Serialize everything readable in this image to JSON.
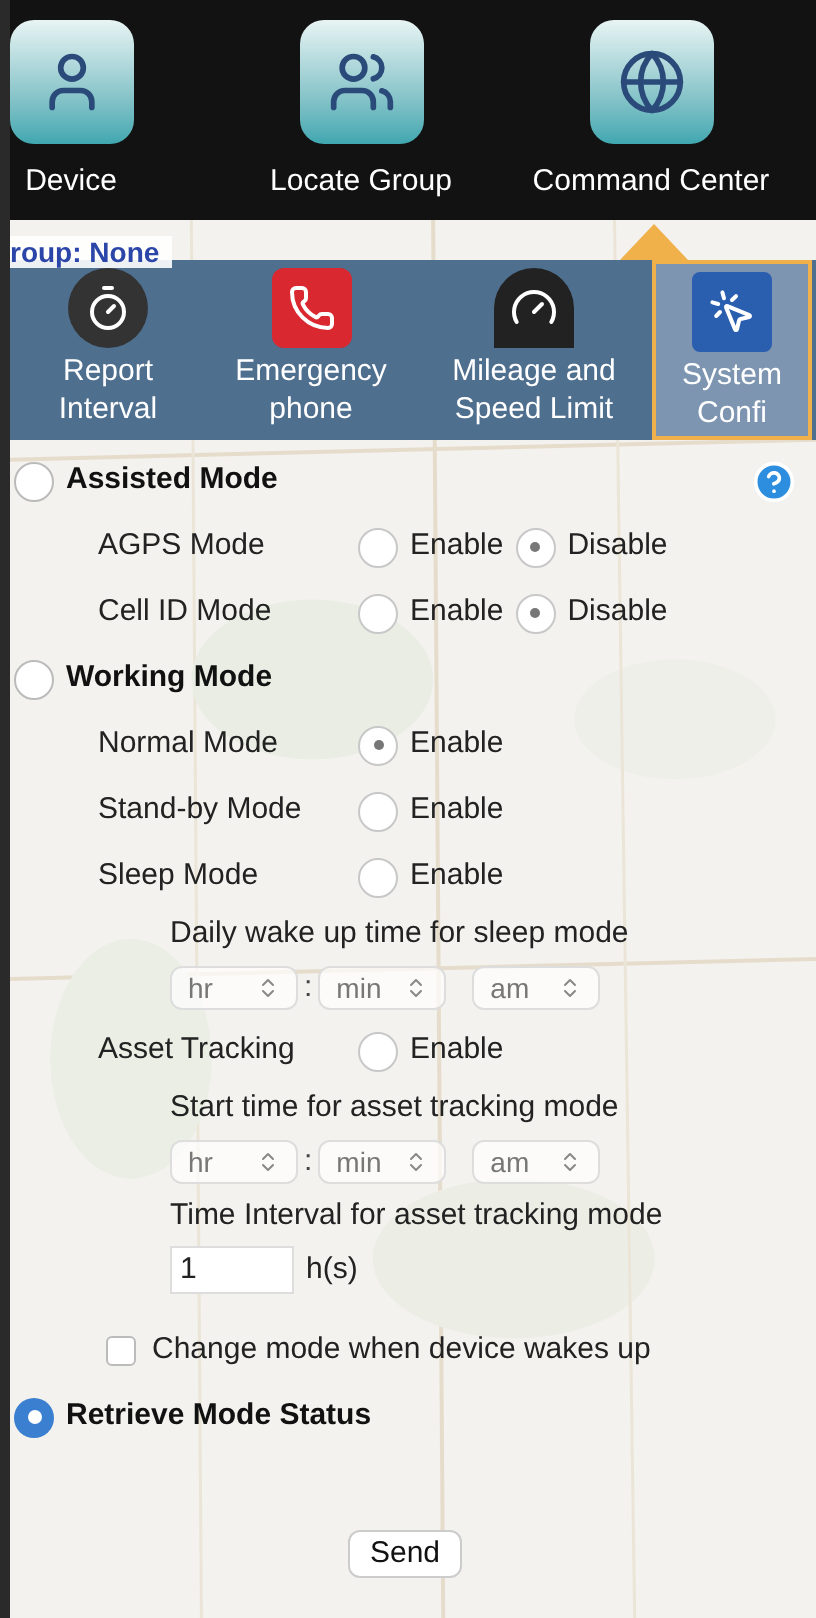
{
  "top_bar": {
    "apps": [
      {
        "label": "Device",
        "kind": "person"
      },
      {
        "label": "Locate Group",
        "kind": "group"
      },
      {
        "label": "Command Center",
        "kind": "globe"
      }
    ]
  },
  "group_label": "roup: None",
  "tool_tabs": [
    {
      "label": "Report Interval",
      "kind": "timer",
      "selected": false
    },
    {
      "label": "Emergency phone",
      "kind": "phone",
      "selected": false
    },
    {
      "label": "Mileage and Speed Limit",
      "kind": "gauge",
      "selected": false
    },
    {
      "label": "System Confi",
      "kind": "pointer",
      "selected": true
    }
  ],
  "modes": [
    {
      "title": "Assisted Mode",
      "selected": false,
      "items": [
        {
          "kind": "toggle",
          "label": "AGPS Mode",
          "options": [
            {
              "label": "Enable",
              "selected": false
            },
            {
              "label": "Disable",
              "selected": true
            }
          ]
        },
        {
          "kind": "toggle",
          "label": "Cell ID Mode",
          "options": [
            {
              "label": "Enable",
              "selected": false
            },
            {
              "label": "Disable",
              "selected": true
            }
          ]
        }
      ]
    },
    {
      "title": "Working Mode",
      "selected": false,
      "items": [
        {
          "kind": "toggle",
          "label": "Normal Mode",
          "options": [
            {
              "label": "Enable",
              "selected": true
            }
          ]
        },
        {
          "kind": "toggle",
          "label": "Stand-by Mode",
          "options": [
            {
              "label": "Enable",
              "selected": false
            }
          ]
        },
        {
          "kind": "toggle",
          "label": "Sleep Mode",
          "options": [
            {
              "label": "Enable",
              "selected": false
            }
          ]
        },
        {
          "kind": "time",
          "caption": "Daily wake up time for sleep mode",
          "fields": [
            "hr",
            "min",
            "am"
          ],
          "separator": ":"
        },
        {
          "kind": "toggle",
          "label": "Asset Tracking",
          "options": [
            {
              "label": "Enable",
              "selected": false
            }
          ]
        },
        {
          "kind": "time",
          "caption": "Start time for asset tracking mode",
          "fields": [
            "hr",
            "min",
            "am"
          ],
          "separator": ":"
        },
        {
          "kind": "number",
          "caption": "Time Interval for asset tracking mode",
          "value": "1",
          "unit": "h(s)"
        },
        {
          "kind": "checkbox",
          "label": "Change mode when device wakes up",
          "checked": false
        }
      ]
    },
    {
      "title": "Retrieve Mode Status",
      "selected": true
    }
  ],
  "send_button": "Send"
}
